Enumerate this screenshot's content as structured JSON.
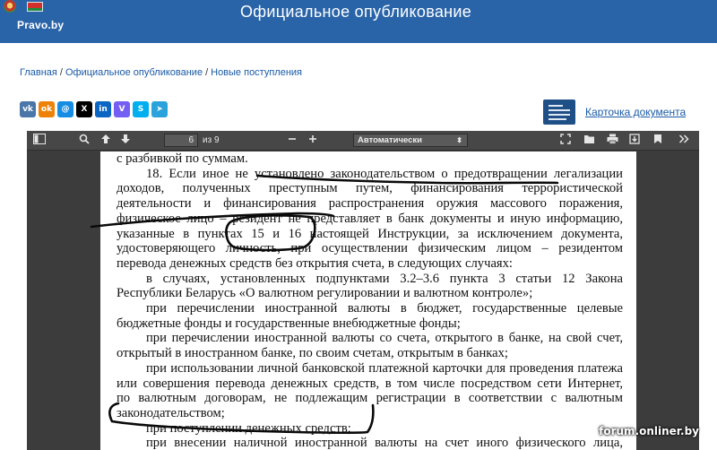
{
  "header": {
    "logo_text": "Pravo.by",
    "title": "Официальное опубликование"
  },
  "breadcrumb": {
    "items": [
      "Главная",
      "Официальное опубликование",
      "Новые поступления"
    ],
    "separator": "/"
  },
  "share": {
    "buttons": [
      {
        "name": "vk",
        "glyph": "vk",
        "color": "#4a76a8"
      },
      {
        "name": "odnoklassniki",
        "glyph": "ok",
        "color": "#ee8208"
      },
      {
        "name": "moimir",
        "glyph": "@",
        "color": "#168de2"
      },
      {
        "name": "x",
        "glyph": "X",
        "color": "#000000"
      },
      {
        "name": "linkedin",
        "glyph": "in",
        "color": "#0a66c2"
      },
      {
        "name": "viber",
        "glyph": "V",
        "color": "#7360f2"
      },
      {
        "name": "skype",
        "glyph": "S",
        "color": "#00aff0"
      },
      {
        "name": "telegram",
        "glyph": "➤",
        "color": "#2aa3dc"
      }
    ],
    "doc_card_label": "Карточка документа"
  },
  "viewer": {
    "current_page": "6",
    "page_of": "из 9",
    "zoom": "Автоматически",
    "icons": {
      "sidebar": "sidebar-toggle-icon",
      "search": "search-icon",
      "prev": "arrow-up-icon",
      "next": "arrow-down-icon",
      "zoom_out": "minus-icon",
      "zoom_in": "plus-icon",
      "fullscreen": "fullscreen-icon",
      "open": "open-file-icon",
      "print": "print-icon",
      "download": "download-icon",
      "bookmark": "bookmark-icon",
      "more": "double-chevron-right-icon"
    }
  },
  "document": {
    "lines": [
      {
        "text": "с разбивкой по суммам.",
        "indent": false,
        "last": true
      },
      {
        "text": "18. Если иное не установлено законодательством о предотвращении легализации",
        "indent": true,
        "last": false
      },
      {
        "text": "доходов, полученных преступным путем, финансирования террористической",
        "indent": false,
        "last": false
      },
      {
        "text": "деятельности и финансирования распространения оружия массового поражения,",
        "indent": false,
        "last": false
      },
      {
        "text": "физическое лицо – резидент не представляет в банк документы и иную информацию,",
        "indent": false,
        "last": false
      },
      {
        "text": "указанные в пунктах 15 и 16 настоящей Инструкции, за исключением документа,",
        "indent": false,
        "last": false
      },
      {
        "text": "удостоверяющего личность, при осуществлении физическим лицом – резидентом",
        "indent": false,
        "last": false
      },
      {
        "text": "перевода денежных средств без открытия счета, в следующих случаях:",
        "indent": false,
        "last": true
      },
      {
        "text": "в случаях, установленных подпунктами 3.2–3.6 пункта 3 статьи 12 Закона",
        "indent": true,
        "last": false
      },
      {
        "text": "Республики Беларусь «О валютном регулировании и валютном контроле»;",
        "indent": false,
        "last": true
      },
      {
        "text": "при перечислении иностранной валюты в бюджет, государственные целевые",
        "indent": true,
        "last": false
      },
      {
        "text": "бюджетные фонды и государственные внебюджетные фонды;",
        "indent": false,
        "last": true
      },
      {
        "text": "при перечислении иностранной валюты со счета, открытого в банке, на свой счет,",
        "indent": true,
        "last": false
      },
      {
        "text": "открытый в иностранном банке, по своим счетам, открытым в банках;",
        "indent": false,
        "last": true
      },
      {
        "text": "при использовании личной банковской платежной карточки для проведения платежа",
        "indent": true,
        "last": false
      },
      {
        "text": "или совершения перевода денежных средств, в том числе посредством сети Интернет,",
        "indent": false,
        "last": false
      },
      {
        "text": "по валютным договорам, не подлежащим регистрации в соответствии с валютным",
        "indent": false,
        "last": false
      },
      {
        "text": "законодательством;",
        "indent": false,
        "last": true
      },
      {
        "text": "при поступлении денежных средств;",
        "indent": true,
        "last": true
      },
      {
        "text": "при внесении наличной иностранной валюты на счет иного физического лица,",
        "indent": true,
        "last": false
      }
    ]
  },
  "watermark": "forum.onliner.by"
}
